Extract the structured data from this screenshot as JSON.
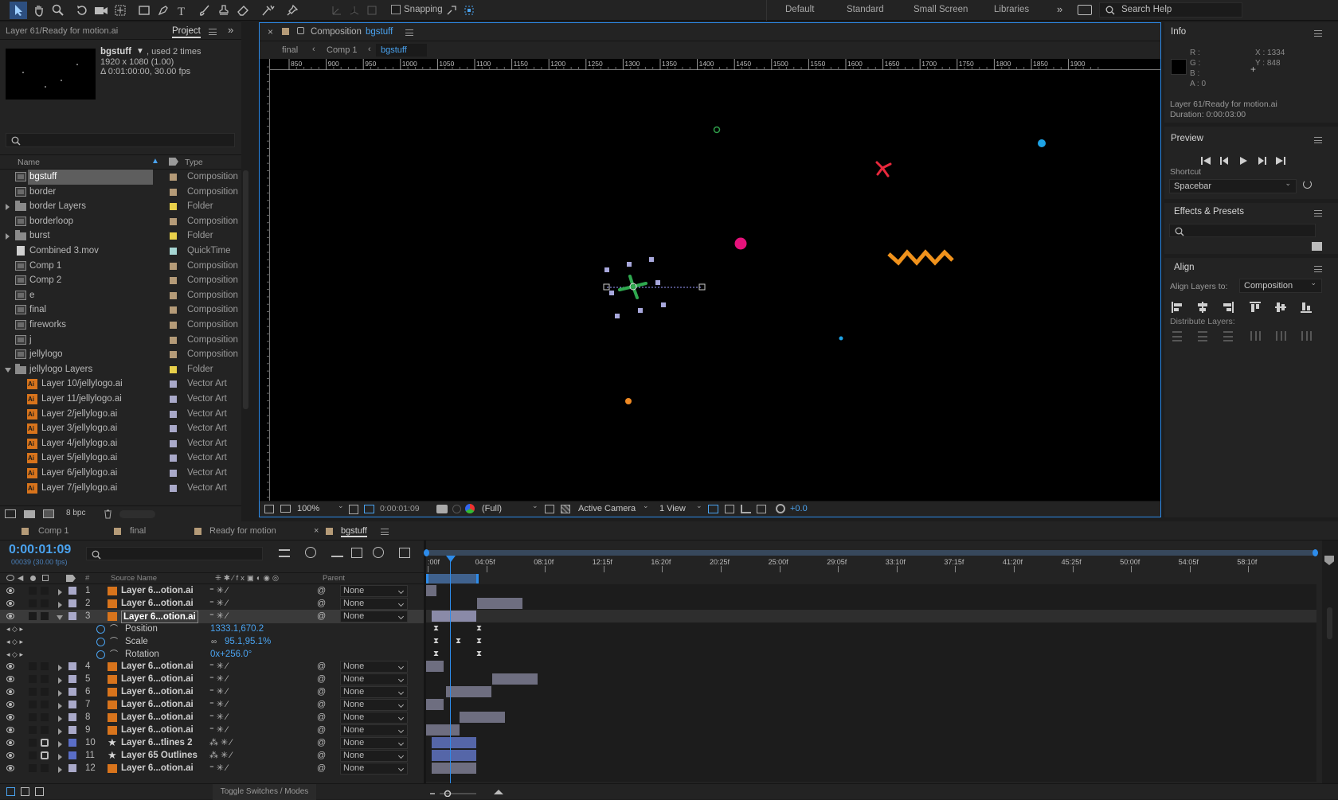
{
  "toolbar": {
    "snapping_label": "Snapping",
    "workspaces": [
      "Default",
      "Standard",
      "Small Screen",
      "Libraries"
    ],
    "search_placeholder": "Search Help"
  },
  "project": {
    "header_title": "Layer 61/Ready for motion.ai",
    "tab_label": "Project",
    "selected_name": "bgstuff",
    "used_times": ", used 2 times",
    "dimensions": "1920 x 1080 (1.00)",
    "duration_fps": "Δ 0:01:00:00, 30.00 fps",
    "col_name": "Name",
    "col_type": "Type",
    "bpc": "8 bpc",
    "items": [
      {
        "name": "bgstuff",
        "type": "Composition",
        "icon": "comp",
        "swatch": "#b59b78",
        "selected": true
      },
      {
        "name": "border",
        "type": "Composition",
        "icon": "comp",
        "swatch": "#b59b78"
      },
      {
        "name": "border Layers",
        "type": "Folder",
        "icon": "folder",
        "swatch": "#e8d04a",
        "twirl": "closed"
      },
      {
        "name": "borderloop",
        "type": "Composition",
        "icon": "comp",
        "swatch": "#b59b78"
      },
      {
        "name": "burst",
        "type": "Folder",
        "icon": "folder",
        "swatch": "#e8d04a",
        "twirl": "closed"
      },
      {
        "name": "Combined 3.mov",
        "type": "QuickTime",
        "icon": "mov",
        "swatch": "#a6d6d3"
      },
      {
        "name": "Comp 1",
        "type": "Composition",
        "icon": "comp",
        "swatch": "#b59b78"
      },
      {
        "name": "Comp 2",
        "type": "Composition",
        "icon": "comp",
        "swatch": "#b59b78"
      },
      {
        "name": "e",
        "type": "Composition",
        "icon": "comp",
        "swatch": "#b59b78"
      },
      {
        "name": "final",
        "type": "Composition",
        "icon": "comp",
        "swatch": "#b59b78"
      },
      {
        "name": "fireworks",
        "type": "Composition",
        "icon": "comp",
        "swatch": "#b59b78"
      },
      {
        "name": "j",
        "type": "Composition",
        "icon": "comp",
        "swatch": "#b59b78"
      },
      {
        "name": "jellylogo",
        "type": "Composition",
        "icon": "comp",
        "swatch": "#b59b78"
      },
      {
        "name": "jellylogo Layers",
        "type": "Folder",
        "icon": "folder",
        "swatch": "#e8d04a",
        "twirl": "open"
      },
      {
        "name": "Layer 10/jellylogo.ai",
        "type": "Vector Art",
        "icon": "ai",
        "swatch": "#a9a9c9",
        "indent": true
      },
      {
        "name": "Layer 11/jellylogo.ai",
        "type": "Vector Art",
        "icon": "ai",
        "swatch": "#a9a9c9",
        "indent": true
      },
      {
        "name": "Layer 2/jellylogo.ai",
        "type": "Vector Art",
        "icon": "ai",
        "swatch": "#a9a9c9",
        "indent": true
      },
      {
        "name": "Layer 3/jellylogo.ai",
        "type": "Vector Art",
        "icon": "ai",
        "swatch": "#a9a9c9",
        "indent": true
      },
      {
        "name": "Layer 4/jellylogo.ai",
        "type": "Vector Art",
        "icon": "ai",
        "swatch": "#a9a9c9",
        "indent": true
      },
      {
        "name": "Layer 5/jellylogo.ai",
        "type": "Vector Art",
        "icon": "ai",
        "swatch": "#a9a9c9",
        "indent": true
      },
      {
        "name": "Layer 6/jellylogo.ai",
        "type": "Vector Art",
        "icon": "ai",
        "swatch": "#a9a9c9",
        "indent": true
      },
      {
        "name": "Layer 7/jellylogo.ai",
        "type": "Vector Art",
        "icon": "ai",
        "swatch": "#a9a9c9",
        "indent": true
      }
    ]
  },
  "composition": {
    "title_prefix": "Composition",
    "title_name": "bgstuff",
    "breadcrumbs": [
      "final",
      "Comp 1",
      "bgstuff"
    ],
    "ruler_labels": [
      "850",
      "900",
      "950",
      "1000",
      "1050",
      "1100",
      "1150",
      "1200",
      "1250",
      "1300",
      "1350",
      "1400",
      "1450",
      "1500",
      "1550",
      "1600",
      "1650",
      "1700",
      "1750",
      "1800",
      "1850",
      "1900"
    ],
    "zoom": "100%",
    "timecode": "0:00:01:09",
    "resolution": "(Full)",
    "camera": "Active Camera",
    "views": "1 View",
    "exposure": "+0.0"
  },
  "info": {
    "title": "Info",
    "r": "R :",
    "g": "G :",
    "b": "B :",
    "a": "A : 0",
    "x": "X : 1334",
    "y": "Y : 848",
    "layer_name": "Layer 61/Ready for motion.ai",
    "duration": "Duration: 0:00:03:00"
  },
  "preview": {
    "title": "Preview",
    "shortcut_label": "Shortcut",
    "shortcut_value": "Spacebar"
  },
  "effects": {
    "title": "Effects & Presets"
  },
  "align": {
    "title": "Align",
    "align_to_label": "Align Layers to:",
    "align_to_value": "Composition",
    "distribute_label": "Distribute Layers:"
  },
  "timeline": {
    "tabs": [
      "Comp 1",
      "final",
      "Ready for motion",
      "bgstuff"
    ],
    "current_time": "0:00:01:09",
    "frame_info": "00039 (30.00 fps)",
    "col_source": "Source Name",
    "col_parent": "Parent",
    "col_num": "#",
    "time_labels": [
      ":00f",
      "04:05f",
      "08:10f",
      "12:15f",
      "16:20f",
      "20:25f",
      "25:00f",
      "29:05f",
      "33:10f",
      "37:15f",
      "41:20f",
      "45:25f",
      "50:00f",
      "54:05f",
      "58:10f"
    ],
    "toggle_label": "Toggle Switches / Modes",
    "layers": [
      {
        "num": "1",
        "name": "Layer 6...otion.ai",
        "parent": "None",
        "bar_start": 0.0,
        "bar_end": 0.012
      },
      {
        "num": "2",
        "name": "Layer 6...otion.ai",
        "parent": "None",
        "bar_start": 0.057,
        "bar_end": 0.108
      },
      {
        "num": "3",
        "name": "Layer 6...otion.ai",
        "parent": "None",
        "bar_start": 0.006,
        "bar_end": 0.056,
        "expanded": true,
        "selected": true
      },
      {
        "num": "4",
        "name": "Layer 6...otion.ai",
        "parent": "None",
        "bar_start": 0.0,
        "bar_end": 0.02
      },
      {
        "num": "5",
        "name": "Layer 6...otion.ai",
        "parent": "None",
        "bar_start": 0.074,
        "bar_end": 0.125
      },
      {
        "num": "6",
        "name": "Layer 6...otion.ai",
        "parent": "None",
        "bar_start": 0.022,
        "bar_end": 0.073
      },
      {
        "num": "7",
        "name": "Layer 6...otion.ai",
        "parent": "None",
        "bar_start": 0.0,
        "bar_end": 0.02
      },
      {
        "num": "8",
        "name": "Layer 6...otion.ai",
        "parent": "None",
        "bar_start": 0.038,
        "bar_end": 0.089
      },
      {
        "num": "9",
        "name": "Layer 6...otion.ai",
        "parent": "None",
        "bar_start": 0.0,
        "bar_end": 0.038
      },
      {
        "num": "10",
        "name": "Layer 6...tlines 2",
        "parent": "None",
        "bar_start": 0.006,
        "bar_end": 0.056,
        "shape": true,
        "locked": true
      },
      {
        "num": "11",
        "name": "Layer 65 Outlines",
        "parent": "None",
        "bar_start": 0.006,
        "bar_end": 0.056,
        "shape": true,
        "locked": true
      },
      {
        "num": "12",
        "name": "Layer 6...otion.ai",
        "parent": "None",
        "bar_start": 0.006,
        "bar_end": 0.056
      }
    ],
    "properties": [
      {
        "name": "Position",
        "value": "1333.1,670.2"
      },
      {
        "name": "Scale",
        "value": "95.1,95.1%"
      },
      {
        "name": "Rotation",
        "value": "0x+256.0°"
      }
    ]
  },
  "colors": {
    "accent": "#2d8ceb",
    "selection": "#2d4f80",
    "ai_orange": "#d8741c"
  }
}
